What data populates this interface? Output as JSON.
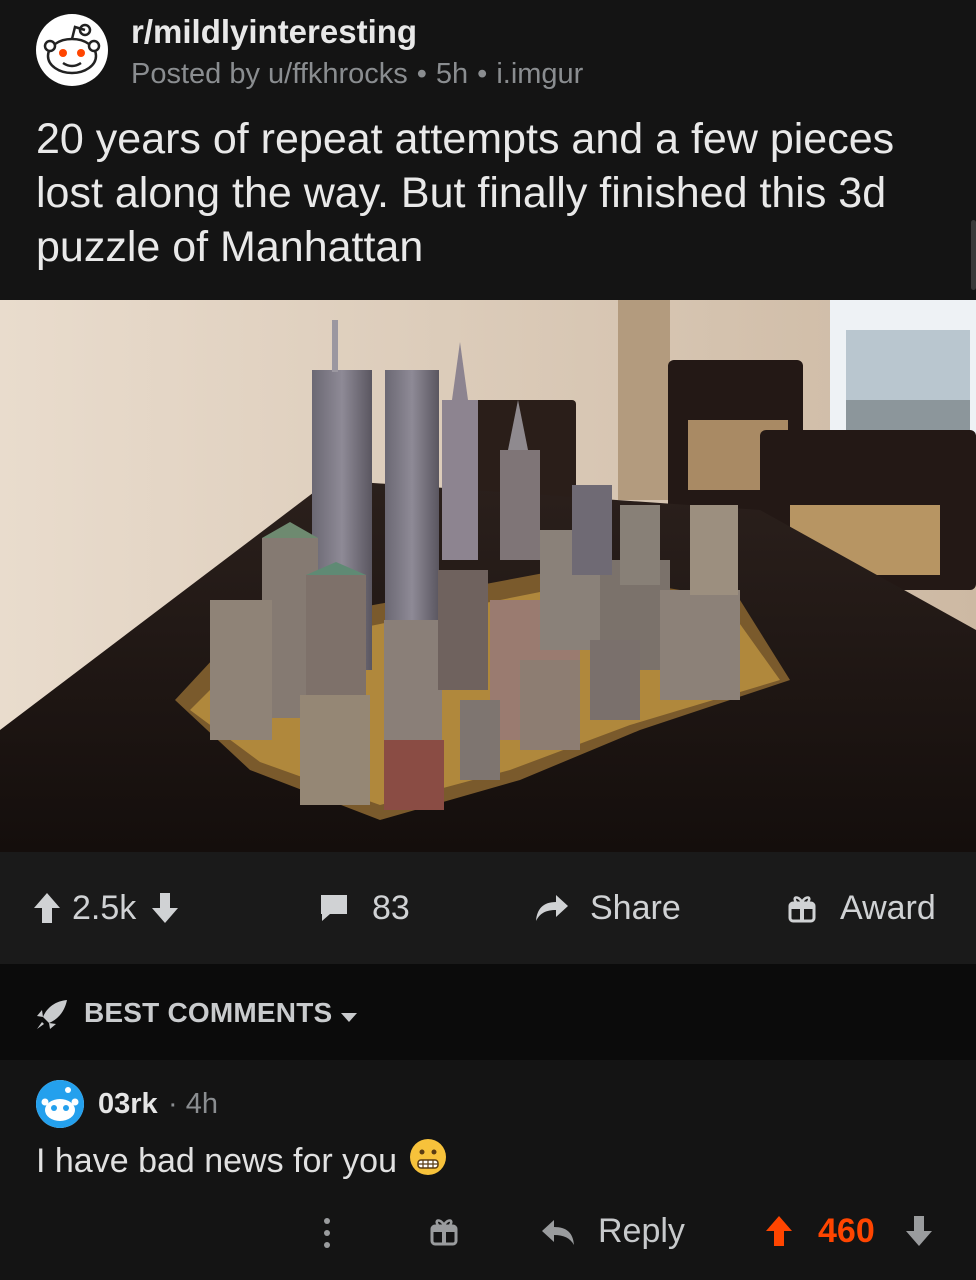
{
  "post": {
    "subreddit": "r/mildlyinteresting",
    "posted_by_prefix": "Posted by",
    "author": "u/ffkhrocks",
    "age": "5h",
    "domain": "i.imgur",
    "separator": "•",
    "title": "20 years of repeat attempts and a few pieces lost along the way. But finally finished this 3d puzzle of Manhattan"
  },
  "actions": {
    "score": "2.5k",
    "comments": "83",
    "share_label": "Share",
    "award_label": "Award"
  },
  "sort": {
    "label": "BEST COMMENTS"
  },
  "comment": {
    "user": "03rk",
    "separator": "·",
    "age": "4h",
    "body": "I have bad news for you",
    "reply_label": "Reply",
    "score": "460"
  },
  "colors": {
    "upvote": "#ff4500",
    "background": "#141414",
    "action_bar": "#1a1a1a",
    "sort_bar": "#0b0b0b"
  }
}
